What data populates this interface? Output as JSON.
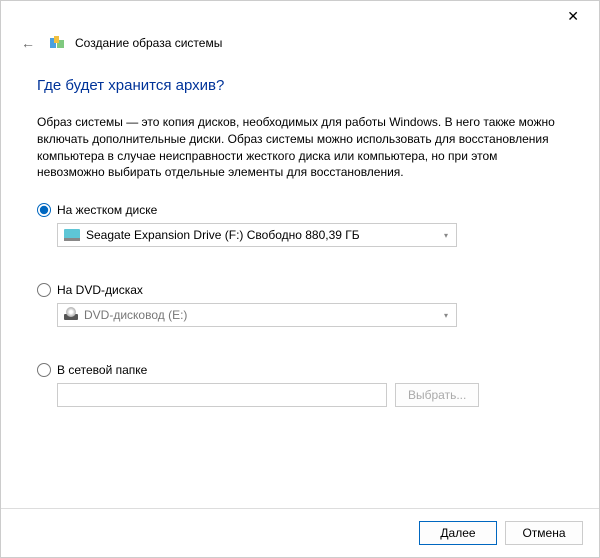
{
  "header": {
    "title": "Создание образа системы"
  },
  "main": {
    "question": "Где будет хранится архив?",
    "description": "Образ системы — это копия дисков, необходимых для работы Windows. В него также можно включать дополнительные диски. Образ системы можно использовать для восстановления компьютера в случае неисправности жесткого диска или компьютера, но при этом невозможно выбирать отдельные элементы для восстановления."
  },
  "options": {
    "hdd": {
      "label": "На жестком диске",
      "selected_text": "Seagate Expansion Drive (F:)  Свободно 880,39 ГБ"
    },
    "dvd": {
      "label": "На DVD-дисках",
      "selected_text": "DVD-дисковод (E:)"
    },
    "network": {
      "label": "В сетевой папке",
      "browse": "Выбрать..."
    }
  },
  "footer": {
    "next": "Далее",
    "cancel": "Отмена"
  }
}
